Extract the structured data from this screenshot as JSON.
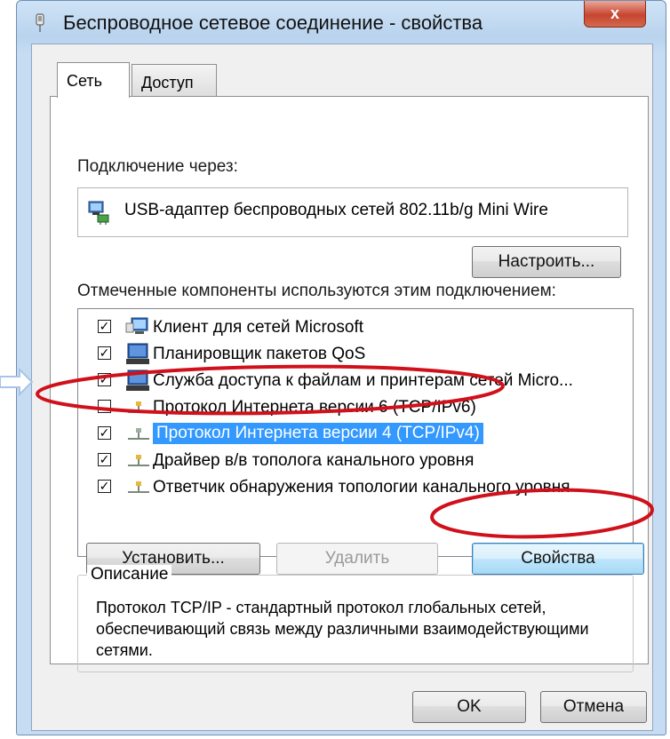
{
  "window": {
    "title": "Беспроводное сетевое соединение - свойства",
    "close_label": "x"
  },
  "tabs": [
    {
      "label": "Сеть",
      "active": true
    },
    {
      "label": "Доступ",
      "active": false
    }
  ],
  "connect_via": {
    "label": "Подключение через:",
    "adapter_name": "USB-адаптер беспроводных сетей 802.11b/g Mini Wire",
    "configure_button": "Настроить..."
  },
  "components": {
    "label": "Отмеченные компоненты используются этим подключением:",
    "items": [
      {
        "label": "Клиент для сетей Microsoft",
        "checked": true,
        "icon": "network-client-icon"
      },
      {
        "label": "Планировщик пакетов QoS",
        "checked": true,
        "icon": "network-service-icon"
      },
      {
        "label": "Служба доступа к файлам и принтерам сетей Micro...",
        "checked": true,
        "icon": "network-service-icon"
      },
      {
        "label": "Протокол Интернета версии 6 (TCP/IPv6)",
        "checked": false,
        "icon": "protocol-icon"
      },
      {
        "label": "Протокол Интернета версии 4 (TCP/IPv4)",
        "checked": true,
        "icon": "protocol-icon",
        "selected": true
      },
      {
        "label": "Драйвер в/в тополога канального уровня",
        "checked": true,
        "icon": "protocol-icon"
      },
      {
        "label": "Ответчик обнаружения топологии канального уровня",
        "checked": true,
        "icon": "protocol-icon"
      }
    ]
  },
  "buttons": {
    "install": "Установить...",
    "uninstall": "Удалить",
    "properties": "Свойства",
    "ok": "OK",
    "cancel": "Отмена"
  },
  "description": {
    "legend": "Описание",
    "text": "Протокол TCP/IP - стандартный протокол глобальных сетей, обеспечивающий связь между различными взаимодействующими сетями."
  },
  "colors": {
    "selection": "#3399ff",
    "annotation": "#d0101a",
    "arrow": "#a9c4e6"
  }
}
